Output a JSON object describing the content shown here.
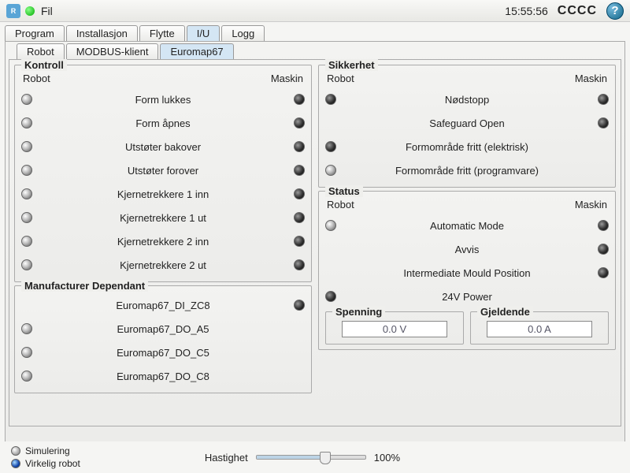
{
  "topbar": {
    "menu": "Fil",
    "time": "15:55:56",
    "cccc": "CCCC"
  },
  "tabs": [
    "Program",
    "Installasjon",
    "Flytte",
    "I/U",
    "Logg"
  ],
  "activeTab": 3,
  "subtabs": [
    "Robot",
    "MODBUS-klient",
    "Euromap67"
  ],
  "activeSubtab": 2,
  "col_headers": {
    "robot": "Robot",
    "maskin": "Maskin"
  },
  "groups": {
    "kontroll": {
      "title": "Kontroll",
      "rows": [
        {
          "l": "gray",
          "label": "Form lukkes",
          "r": "dark"
        },
        {
          "l": "gray",
          "label": "Form åpnes",
          "r": "dark"
        },
        {
          "l": "gray",
          "label": "Utstøter bakover",
          "r": "dark"
        },
        {
          "l": "gray",
          "label": "Utstøter forover",
          "r": "dark"
        },
        {
          "l": "gray",
          "label": "Kjernetrekkere 1 inn",
          "r": "dark"
        },
        {
          "l": "gray",
          "label": "Kjernetrekkere 1 ut",
          "r": "dark"
        },
        {
          "l": "gray",
          "label": "Kjernetrekkere 2 inn",
          "r": "dark"
        },
        {
          "l": "gray",
          "label": "Kjernetrekkere 2 ut",
          "r": "dark"
        }
      ]
    },
    "manuf": {
      "title": "Manufacturer Dependant",
      "rows": [
        {
          "l": "none",
          "label": "Euromap67_DI_ZC8",
          "r": "dark"
        },
        {
          "l": "gray",
          "label": "Euromap67_DO_A5",
          "r": "none"
        },
        {
          "l": "gray",
          "label": "Euromap67_DO_C5",
          "r": "none"
        },
        {
          "l": "gray",
          "label": "Euromap67_DO_C8",
          "r": "none"
        }
      ]
    },
    "sikkerhet": {
      "title": "Sikkerhet",
      "rows": [
        {
          "l": "dark",
          "label": "Nødstopp",
          "r": "dark"
        },
        {
          "l": "none",
          "label": "Safeguard Open",
          "r": "dark"
        },
        {
          "l": "dark",
          "label": "Formområde fritt (elektrisk)",
          "r": "none"
        },
        {
          "l": "gray",
          "label": "Formområde fritt (programvare)",
          "r": "none"
        }
      ]
    },
    "status": {
      "title": "Status",
      "rows": [
        {
          "l": "gray",
          "label": "Automatic Mode",
          "r": "dark"
        },
        {
          "l": "none",
          "label": "Avvis",
          "r": "dark"
        },
        {
          "l": "none",
          "label": "Intermediate Mould Position",
          "r": "dark"
        },
        {
          "l": "dark",
          "label": "24V Power",
          "r": "none"
        }
      ]
    }
  },
  "spenning": {
    "title": "Spenning",
    "value": "0.0 V"
  },
  "gjeldende": {
    "title": "Gjeldende",
    "value": "0.0 A"
  },
  "footer": {
    "sim": "Simulering",
    "real": "Virkelig robot",
    "speed_label": "Hastighet",
    "speed_value": "100%"
  }
}
